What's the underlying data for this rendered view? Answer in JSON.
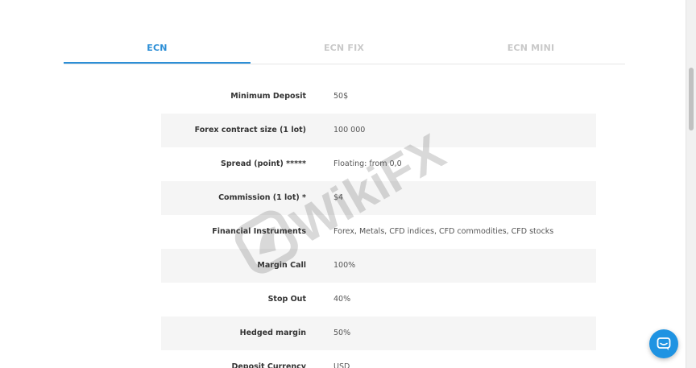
{
  "tabs": [
    {
      "label": "ECN",
      "active": true
    },
    {
      "label": "ECN FIX",
      "active": false
    },
    {
      "label": "ECN MINI",
      "active": false
    }
  ],
  "spec_rows": [
    {
      "label": "Minimum Deposit",
      "value": "50$"
    },
    {
      "label": "Forex contract size (1 lot)",
      "value": "100 000"
    },
    {
      "label": "Spread (point) *****",
      "value": "Floating: from 0,0"
    },
    {
      "label": "Commission (1 lot) *",
      "value": "$4"
    },
    {
      "label": "Financial Instruments",
      "value": "Forex, Metals, CFD indices, CFD commodities, CFD stocks"
    },
    {
      "label": "Margin Call",
      "value": "100%"
    },
    {
      "label": "Stop Out",
      "value": "40%"
    },
    {
      "label": "Hedged margin",
      "value": "50%"
    },
    {
      "label": "Deposit Currency",
      "value": "USD"
    }
  ],
  "watermark": {
    "text": "WikiFX"
  },
  "colors": {
    "accent": "#2d8fd6",
    "chat": "#1f93e2",
    "row_shade": "#f5f5f5"
  },
  "icons": {
    "chat": "chat-bubble-icon",
    "watermark_logo": "wikifx-logo-icon"
  }
}
